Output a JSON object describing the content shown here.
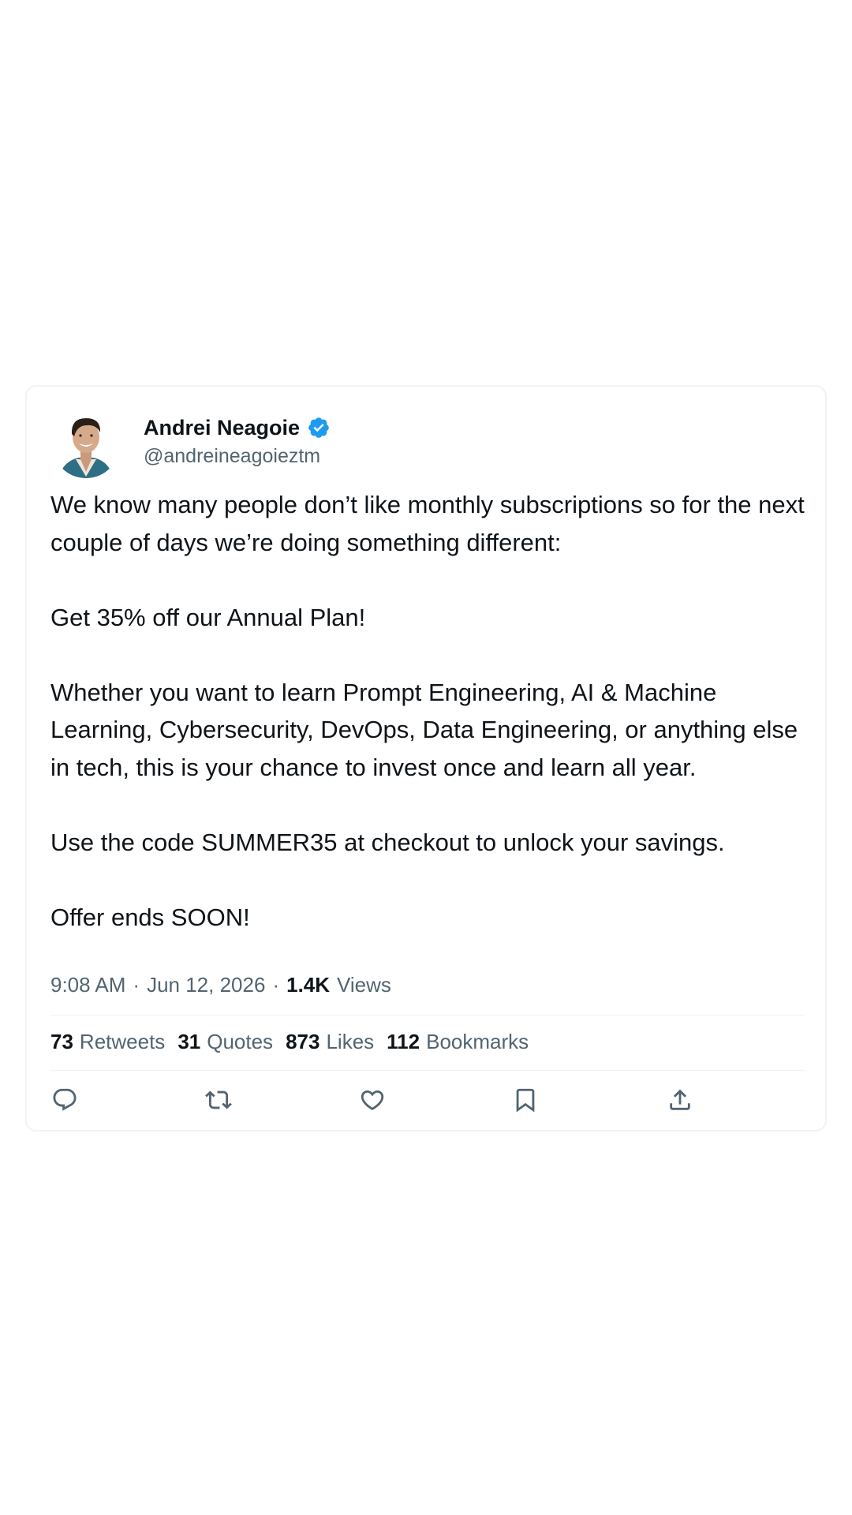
{
  "tweet": {
    "author_name": "Andrei Neagoie",
    "handle": "@andreineagoieztm",
    "paragraphs": [
      "We know many people don’t like monthly subscriptions so for the next couple of days we’re doing something different:",
      "Get 35% off our Annual Plan!",
      "Whether you want to learn Prompt Engineering, AI & Machine Learning, Cybersecurity, DevOps, Data Engineering, or anything else in tech, this is your chance to invest once and learn all year.",
      "Use the code SUMMER35 at checkout to unlock your savings.",
      "Offer ends SOON!"
    ],
    "time": "9:08 AM",
    "date": "Jun 12, 2026",
    "separator": "·",
    "views_count": "1.4K",
    "views_label": "Views"
  },
  "stats": {
    "retweets_count": "73",
    "retweets_label": "Retweets",
    "quotes_count": "31",
    "quotes_label": "Quotes",
    "likes_count": "873",
    "likes_label": "Likes",
    "bookmarks_count": "112",
    "bookmarks_label": "Bookmarks"
  },
  "actions": {
    "reply_icon": "reply-icon",
    "retweet_icon": "retweet-icon",
    "like_icon": "heart-icon",
    "bookmark_icon": "bookmark-icon",
    "share_icon": "share-icon"
  },
  "colors": {
    "text_primary": "#0f1419",
    "text_secondary": "#536471",
    "verified_blue": "#1d9bf0",
    "border": "#eff3f4"
  }
}
